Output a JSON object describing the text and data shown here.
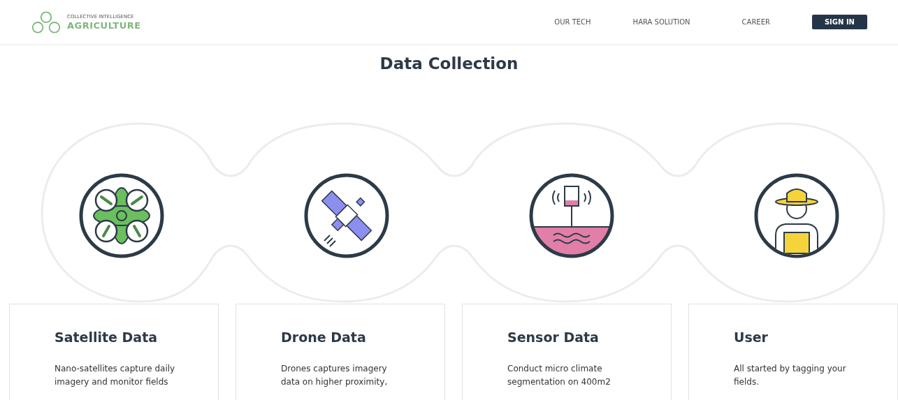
{
  "header": {
    "logo": {
      "tagline": "COLLECTIVE INTELLIGENCE",
      "name": "AGRICULTURE"
    },
    "nav": [
      {
        "label": "OUR TECH",
        "kind": "link"
      },
      {
        "label": "HARA SOLUTION",
        "kind": "link"
      },
      {
        "label": "CAREER",
        "kind": "link"
      },
      {
        "label": "SIGN IN",
        "kind": "button"
      }
    ]
  },
  "title": "Data Collection",
  "sources": [
    {
      "kind": "drone",
      "title": "Satellite Data",
      "description_lines": [
        "Nano-satellites capture daily",
        "imagery and monitor fields"
      ]
    },
    {
      "kind": "satellite",
      "title": "Drone Data",
      "description_lines": [
        "Drones captures imagery",
        "data on higher proximity,"
      ]
    },
    {
      "kind": "sensor",
      "title": "Sensor Data",
      "description_lines": [
        "Conduct micro climate",
        "segmentation on 400m2"
      ]
    },
    {
      "kind": "farmer",
      "title": "User",
      "description_lines": [
        "All started by tagging your",
        "fields."
      ]
    }
  ]
}
